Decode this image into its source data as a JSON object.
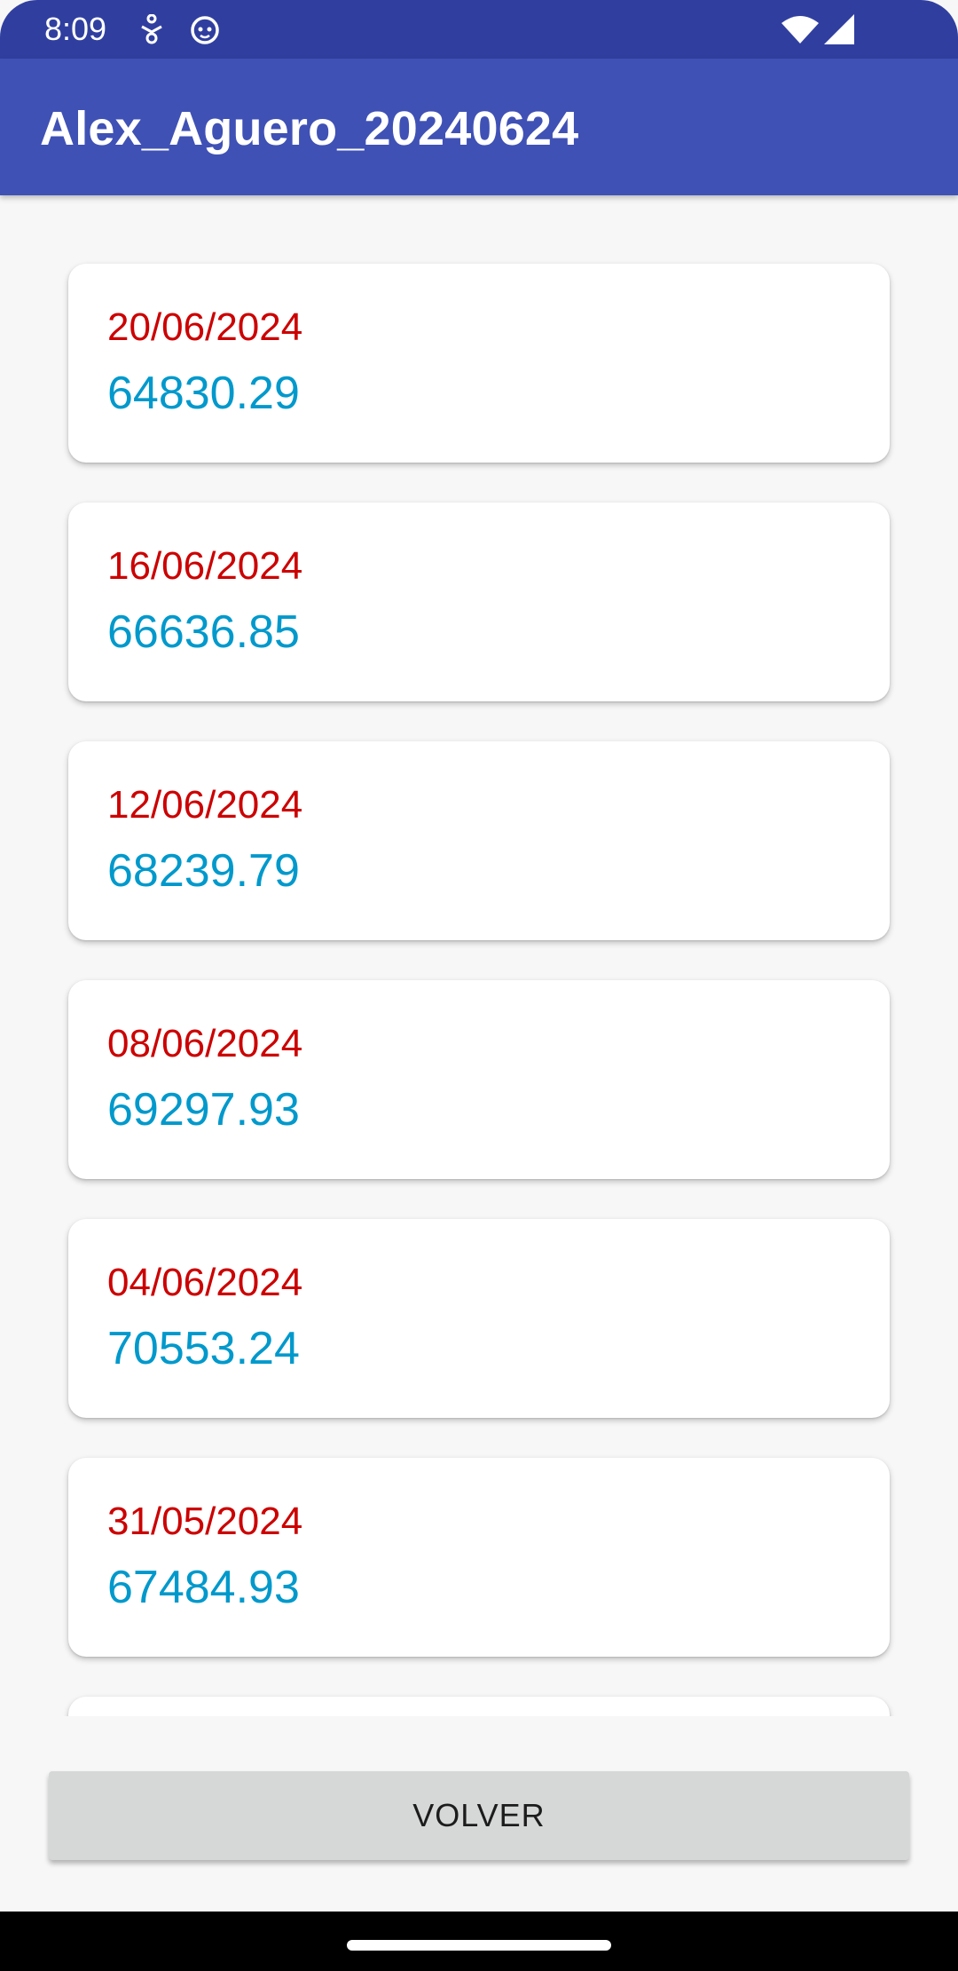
{
  "status_bar": {
    "time": "8:09",
    "left_icons": [
      "accessibility-icon",
      "cat-face-icon"
    ],
    "right_icons": [
      "wifi-icon",
      "cellular-signal-icon"
    ]
  },
  "app_bar": {
    "title": "Alex_Aguero_20240624",
    "color": "#3f51b5",
    "status_color": "#303f9f"
  },
  "list": {
    "date_color": "#cc0000",
    "value_color": "#0099cc",
    "items": [
      {
        "date": "20/06/2024",
        "value": "64830.29"
      },
      {
        "date": "16/06/2024",
        "value": "66636.85"
      },
      {
        "date": "12/06/2024",
        "value": "68239.79"
      },
      {
        "date": "08/06/2024",
        "value": "69297.93"
      },
      {
        "date": "04/06/2024",
        "value": "70553.24"
      },
      {
        "date": "31/05/2024",
        "value": "67484.93"
      }
    ]
  },
  "back_button": {
    "label": "VOLVER"
  }
}
